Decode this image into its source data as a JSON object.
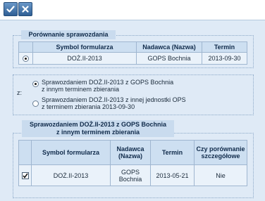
{
  "toolbar": {
    "confirm_icon": "check-icon",
    "cancel_icon": "close-icon"
  },
  "comparison": {
    "legend": "Porównanie sprawozdania",
    "columns": [
      "Symbol formularza",
      "Nadawca (Nazwa)",
      "Termin"
    ],
    "rows": [
      {
        "selected": true,
        "symbol": "DOŻ.II-2013",
        "sender": "GOPS Bochnia",
        "deadline": "2013-09-30"
      }
    ]
  },
  "compare_with": {
    "label": "z:",
    "options": [
      {
        "selected": true,
        "line1": "Sprawozdaniem DOŻ.II-2013 z GOPS Bochnia",
        "line2": "z innym terminem zbierania"
      },
      {
        "selected": false,
        "line1": "Sprawozdaniem DOŻ.II-2013 z innej jednostki OPS",
        "line2": "z terminem zbierania 2013-09-30"
      }
    ]
  },
  "other_reports": {
    "legend_line1": "Sprawozdaniem DOŻ.II-2013 z GOPS Bochnia",
    "legend_line2": "z innym terminem zbierania",
    "columns": {
      "symbol": "Symbol formularza",
      "sender": "Nadawca (Nazwa)",
      "deadline": "Termin",
      "compared": "Czy porównanie szczegółowe"
    },
    "rows": [
      {
        "checked": true,
        "symbol": "DOŻ.II-2013",
        "sender": "GOPS Bochnia",
        "deadline": "2013-05-21",
        "compared": "Nie"
      }
    ]
  },
  "colors": {
    "panel_bg": "#dfeaf6",
    "header_bg": "#cddff1",
    "legend_bg": "#c9dbee",
    "button_blue": "#2f5f95"
  }
}
